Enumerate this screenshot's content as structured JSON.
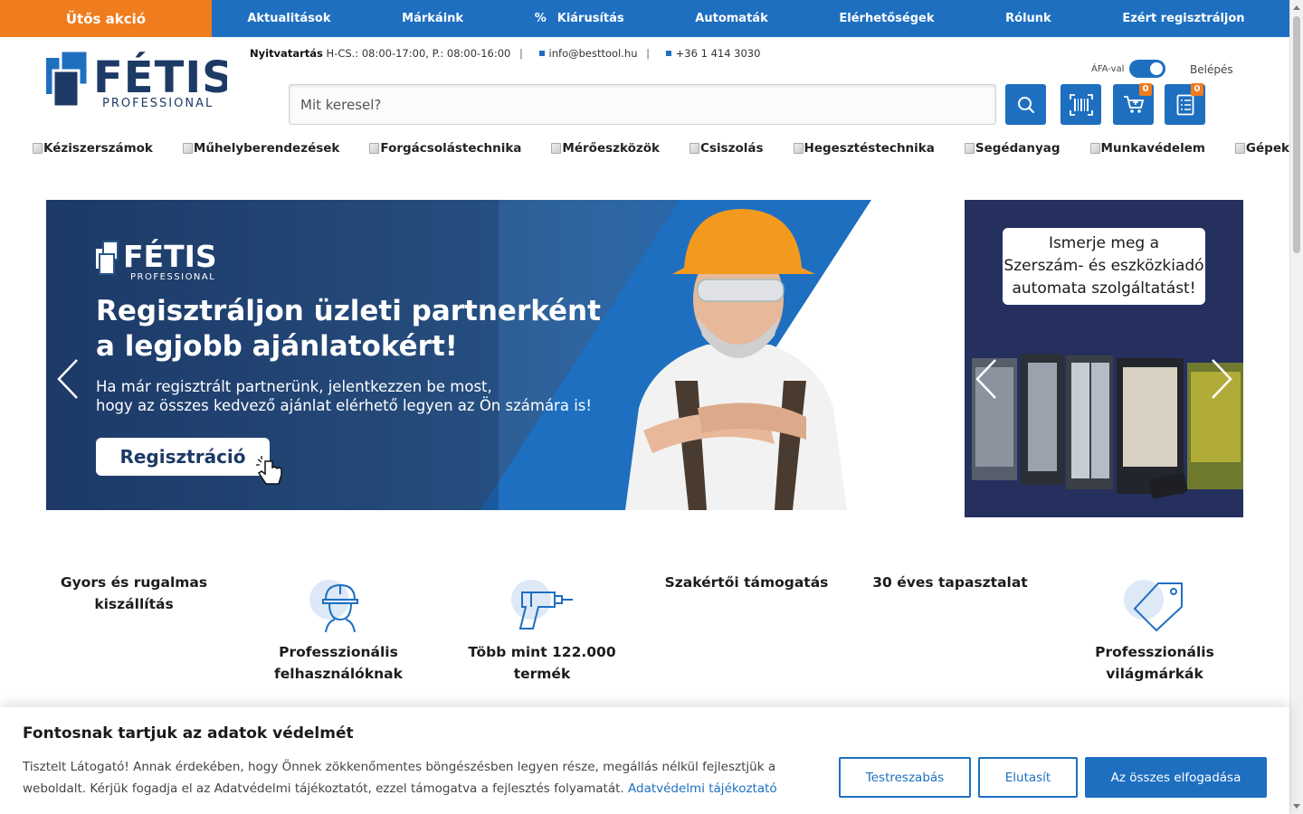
{
  "topbar": {
    "promo": "Ütős akció",
    "nav": [
      "Aktualitások",
      "Márkáink",
      "Kiárusítás",
      "Automaták",
      "Elérhetőségek",
      "Rólunk",
      "Ezért regisztráljon"
    ],
    "sale_prefix": "%"
  },
  "header": {
    "logo_text": "FÉTIS",
    "logo_sub": "PROFESSIONAL",
    "opening_label": "Nyitvatartás",
    "opening_hours": "H-CS.: 08:00-17:00, P.: 08:00-16:00",
    "email": "info@besttool.hu",
    "phone": "+36 1 414 3030",
    "vat_label": "ÁFA-val",
    "login": "Belépés",
    "search_placeholder": "Mit keresel?",
    "cart_count": "0",
    "list_count": "0"
  },
  "categories": [
    "Kéziszerszámok",
    "Műhelyberendezések",
    "Forgácsolástechnika",
    "Mérőeszközök",
    "Csiszolás",
    "Hegesztéstechnika",
    "Segédanyag",
    "Munkavédelem",
    "Gépek"
  ],
  "banner": {
    "logo_text": "FÉTIS",
    "logo_sub": "PROFESSIONAL",
    "headline_1": "Regisztráljon üzleti partnerként",
    "headline_2": "a legjobb ajánlatokért!",
    "body_1": "Ha már regisztrált partnerünk, jelentkezzen be most,",
    "body_2": "hogy az összes kedvező ajánlat elérhető legyen az Ön számára is!",
    "button": "Regisztráció"
  },
  "side_banner": {
    "line_1": "Ismerje meg a",
    "line_2": "Szerszám- és eszközkiadó",
    "line_3": "automata szolgáltatást!"
  },
  "features": [
    "Gyors és rugalmas kiszállítás",
    "Professzionális felhasználóknak",
    "Több mint 122.000 termék",
    "Szakértői támogatás",
    "30 éves tapasztalat",
    "Professzionális világmárkák"
  ],
  "cookie": {
    "title": "Fontosnak tartjuk az adatok védelmét",
    "text": "Tisztelt Látogató! Annak érdekében, hogy Önnek zökkenőmentes böngészésben legyen része, megállás nélkül fejlesztjük a weboldalt.  Kérjük fogadja el az Adatvédelmi tájékoztatót, ezzel támogatva a fejlesztés folyamatát.",
    "link": "Adatvédelmi tájékoztató",
    "customize": "Testreszabás",
    "reject": "Elutasít",
    "accept_all": "Az összes elfogadása"
  },
  "colors": {
    "brand_blue": "#1e6fc0",
    "accent_orange": "#ef7c1d",
    "navy": "#25305f"
  },
  "icons": {
    "search": "search-icon",
    "barcode": "barcode-icon",
    "cart": "cart-icon",
    "list": "list-icon"
  }
}
